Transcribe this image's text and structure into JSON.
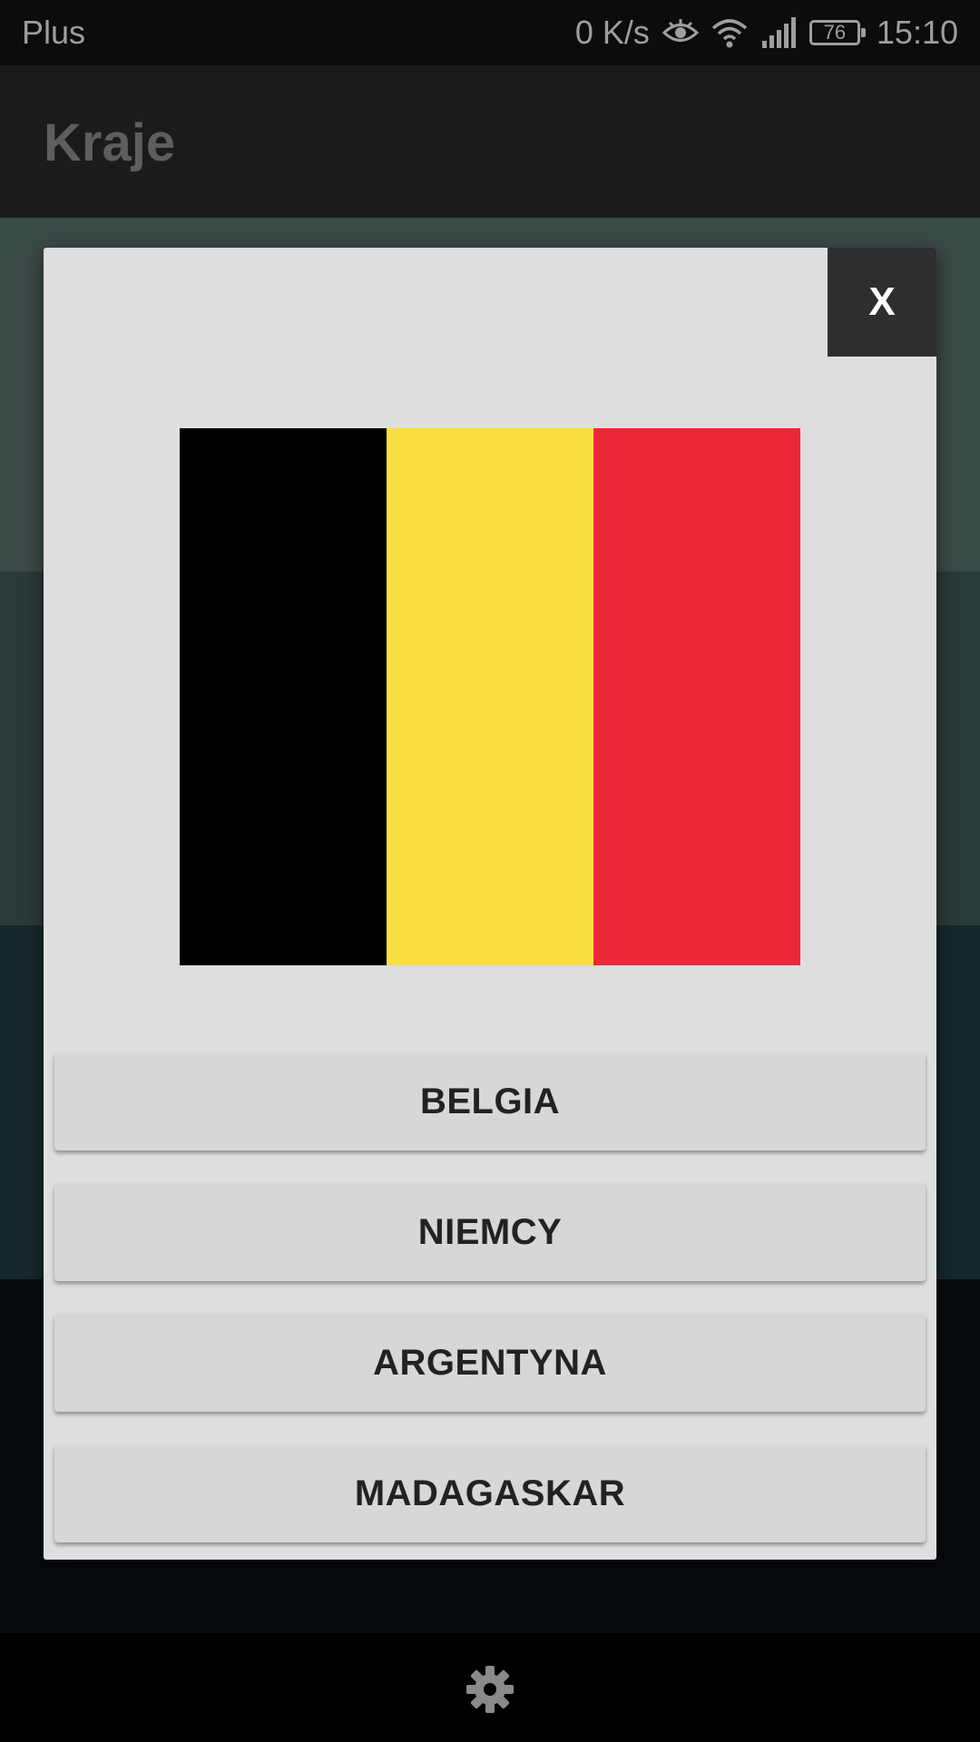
{
  "status_bar": {
    "carrier": "Plus",
    "network_speed": "0 K/s",
    "battery_level": "76",
    "time": "15:10",
    "icons": [
      "eye-icon",
      "wifi-icon",
      "signal-icon",
      "battery-icon"
    ]
  },
  "app_bar": {
    "title": "Kraje"
  },
  "dialog": {
    "close_label": "X",
    "flag": {
      "icon": "belgium-flag",
      "stripes": [
        "#000000",
        "#F9DF42",
        "#EC2838"
      ]
    },
    "answers": [
      {
        "label": "BELGIA"
      },
      {
        "label": "NIEMCY"
      },
      {
        "label": "ARGENTYNA"
      },
      {
        "label": "MADAGASKAR"
      }
    ]
  },
  "bottom_bar": {
    "icon": "gear-icon"
  },
  "colors": {
    "dialog_background": "#dedede",
    "close_button_background": "#2e2e2e",
    "answer_button_background": "#d6d7d7",
    "app_bar_background": "#1b1b1b"
  }
}
